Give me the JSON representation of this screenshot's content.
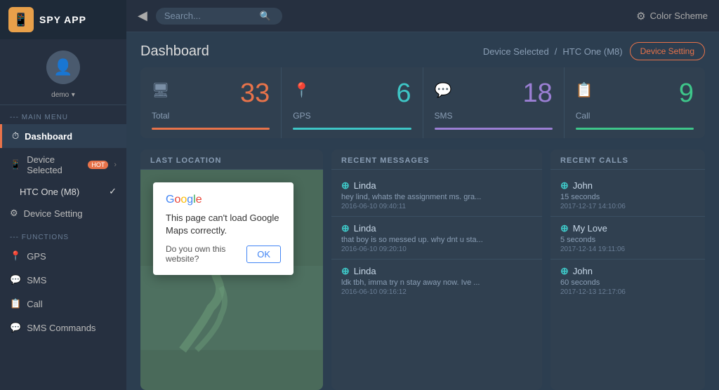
{
  "sidebar": {
    "logo_icon": "📱",
    "logo_text": "SPY APP",
    "profile": {
      "avatar_icon": "👤",
      "username": "demo",
      "dropdown_icon": "▾"
    },
    "main_menu_label": "--- MAIN MENU",
    "items": [
      {
        "id": "dashboard",
        "label": "Dashboard",
        "icon": "⏱",
        "active": true
      },
      {
        "id": "device-selected",
        "label": "Device Selected",
        "badge": "HOT",
        "icon": "📱",
        "arrow": "›"
      },
      {
        "id": "htc-one",
        "label": "HTC One (M8)",
        "check": "✓"
      },
      {
        "id": "device-setting",
        "label": "Device Setting",
        "icon": "⚙"
      }
    ],
    "functions_label": "--- FUNCTIONS",
    "functions": [
      {
        "id": "gps",
        "label": "GPS",
        "icon": "📍"
      },
      {
        "id": "sms",
        "label": "SMS",
        "icon": "💬"
      },
      {
        "id": "call",
        "label": "Call",
        "icon": "📋"
      },
      {
        "id": "sms-commands",
        "label": "SMS Commands",
        "icon": "💬"
      }
    ]
  },
  "topbar": {
    "back_icon": "◁",
    "search_placeholder": "Search...",
    "search_icon": "🔍",
    "color_scheme_icon": "⚙",
    "color_scheme_label": "Color Scheme"
  },
  "dashboard": {
    "title": "Dashboard",
    "breadcrumb": {
      "device_selected": "Device Selected",
      "separator": "/",
      "device_name": "HTC One (M8)"
    },
    "device_setting_btn": "Device Setting"
  },
  "stats": [
    {
      "id": "total",
      "icon": "🖥",
      "value": "33",
      "label": "Total",
      "bar_class": "bar-orange",
      "value_class": "color-orange"
    },
    {
      "id": "gps",
      "icon": "📍",
      "value": "6",
      "label": "GPS",
      "bar_class": "bar-teal",
      "value_class": "color-teal"
    },
    {
      "id": "sms",
      "icon": "💬",
      "value": "18",
      "label": "SMS",
      "bar_class": "bar-purple",
      "value_class": "color-purple"
    },
    {
      "id": "call",
      "icon": "📋",
      "value": "9",
      "label": "Call",
      "bar_class": "bar-green",
      "value_class": "color-green"
    }
  ],
  "location_panel": {
    "header": "LAST LOCATION",
    "map_dialog": {
      "google_text": "Google",
      "message": "This page can't load Google Maps correctly.",
      "question": "Do you own this website?",
      "ok_button": "OK"
    }
  },
  "messages_panel": {
    "header": "RECENT MESSAGES",
    "items": [
      {
        "sender": "Linda",
        "text": "hey lind, whats the assignment ms. gra...",
        "time": "2016-06-10 09:40:11"
      },
      {
        "sender": "Linda",
        "text": "that boy is so messed up. why dnt u sta...",
        "time": "2016-06-10 09:20:10"
      },
      {
        "sender": "Linda",
        "text": "ldk tbh, imma try n stay away now. Ive ...",
        "time": "2016-06-10 09:16:12"
      }
    ]
  },
  "calls_panel": {
    "header": "RECENT CALLS",
    "items": [
      {
        "sender": "John",
        "duration": "15 seconds",
        "time": "2017-12-17 14:10:06"
      },
      {
        "sender": "My Love",
        "duration": "5 seconds",
        "time": "2017-12-14 19:11:06"
      },
      {
        "sender": "John",
        "duration": "60 seconds",
        "time": "2017-12-13 12:17:06"
      }
    ]
  }
}
